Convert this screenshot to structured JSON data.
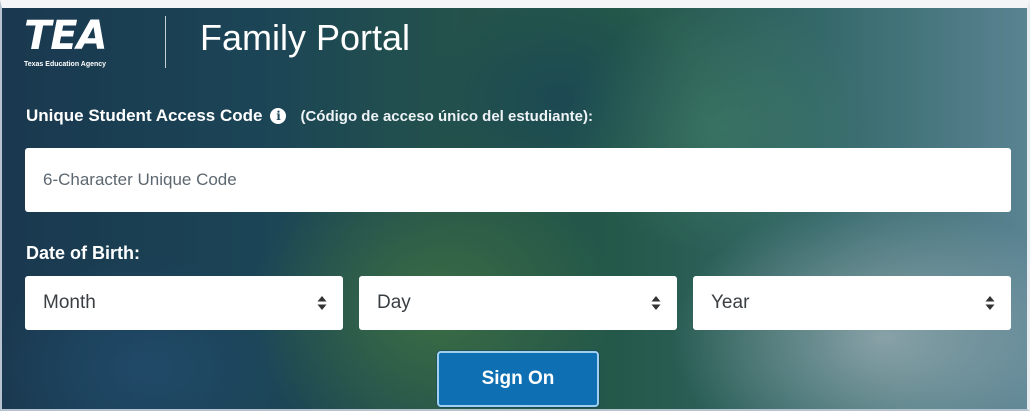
{
  "header": {
    "logo_text": "TEA",
    "logo_subtitle": "Texas Education Agency",
    "title": "Family Portal"
  },
  "access_code": {
    "label": "Unique Student Access Code",
    "label_spanish": "(Código de acceso único del estudiante):",
    "info_icon": "info-circle-icon",
    "placeholder": "6-Character Unique Code",
    "value": ""
  },
  "date_of_birth": {
    "label": "Date of Birth:",
    "month": {
      "selected": "Month",
      "icon": "sort-arrows-icon"
    },
    "day": {
      "selected": "Day",
      "icon": "sort-arrows-icon"
    },
    "year": {
      "selected": "Year",
      "icon": "sort-arrows-icon"
    }
  },
  "actions": {
    "sign_on_label": "Sign On"
  },
  "colors": {
    "button": "#0f6fb3",
    "button_border": "#9fd0ef",
    "text_on_background": "#ffffff"
  }
}
